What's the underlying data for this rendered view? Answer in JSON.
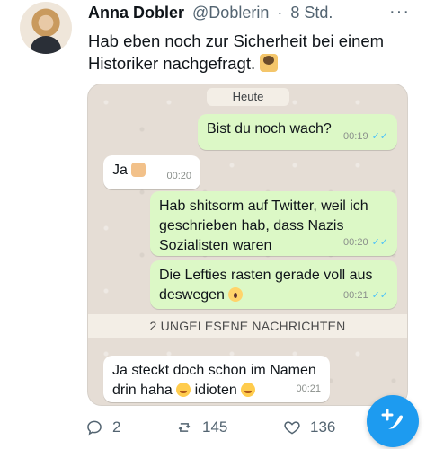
{
  "tweet": {
    "author_name": "Anna Dobler",
    "handle": "@Doblerin",
    "dot": "·",
    "time": "8 Std.",
    "more": "···",
    "text": "Hab eben noch zur Sicherheit bei einem Historiker nachgefragt."
  },
  "chat": {
    "date_label": "Heute",
    "messages": [
      {
        "dir": "out",
        "text": "Bist du noch wach?",
        "time": "00:19",
        "ticks": "✓✓"
      },
      {
        "dir": "in",
        "text": "Ja",
        "time": "00:20"
      },
      {
        "dir": "out",
        "text": "Hab shitsorm auf Twitter, weil ich geschrieben hab, dass Nazis Sozialisten waren",
        "time": "00:20",
        "ticks": "✓✓"
      },
      {
        "dir": "out",
        "text": "Die Lefties rasten gerade voll aus deswegen",
        "time": "00:21",
        "ticks": "✓✓"
      },
      {
        "dir": "in",
        "text1": "Ja steckt doch schon im Namen",
        "text2a": "drin haha",
        "text2b": "idioten",
        "time": "00:21"
      }
    ],
    "unread_label": "2 UNGELESENE NACHRICHTEN"
  },
  "actions": {
    "reply_count": "2",
    "retweet_count": "145",
    "like_count": "136"
  },
  "icons": {
    "reply": "reply-icon",
    "retweet": "retweet-icon",
    "like": "heart-icon",
    "compose": "compose-icon",
    "more": "more-icon"
  },
  "colors": {
    "accent": "#1d9bf0",
    "bubble_out": "#dcf8c6",
    "bubble_in": "#ffffff",
    "chat_bg": "#e5ddd5",
    "ticks": "#4fc3f7"
  }
}
